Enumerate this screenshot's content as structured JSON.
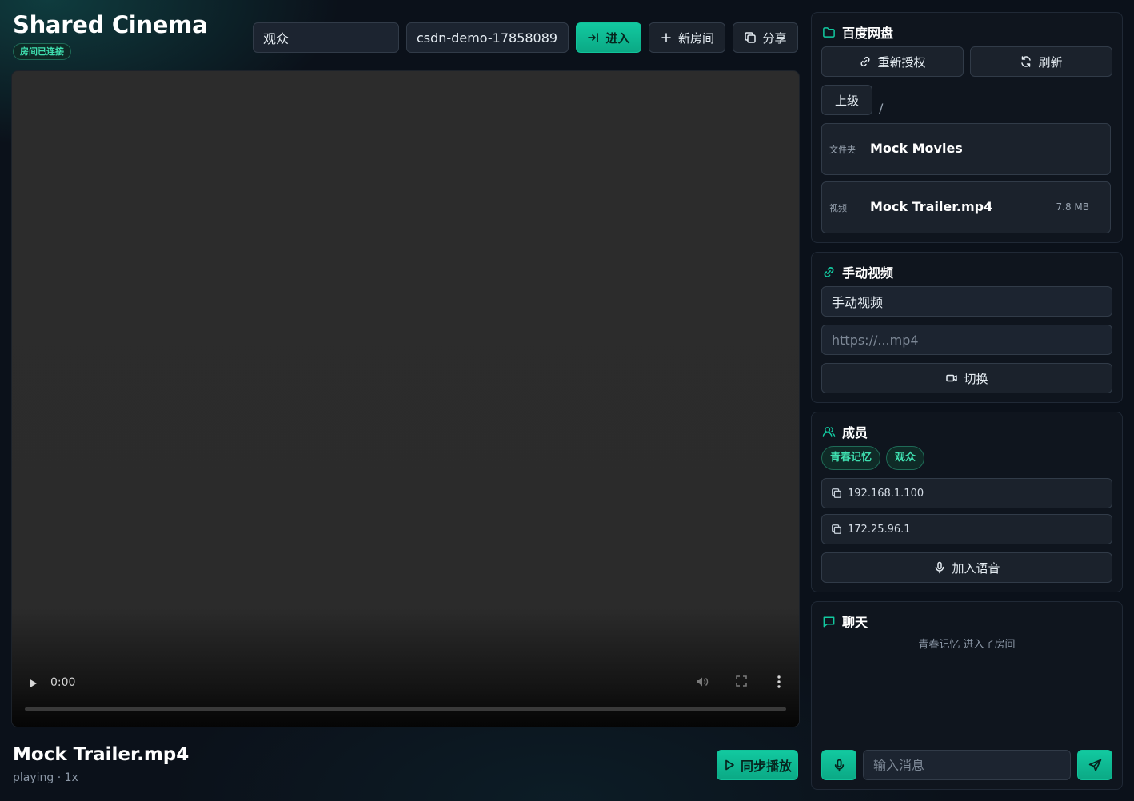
{
  "header": {
    "title": "Shared Cinema",
    "status_badge": "房间已连接",
    "nickname_value": "观众",
    "room_value": "csdn-demo-178580898",
    "enter_label": "进入",
    "new_room_label": "新房间",
    "share_label": "分享"
  },
  "player": {
    "time": "0:00",
    "now_title": "Mock Trailer.mp4",
    "now_status": "playing · 1x",
    "sync_label": "同步播放"
  },
  "baidu": {
    "title": "百度网盘",
    "reauth_label": "重新授权",
    "refresh_label": "刷新",
    "up_label": "上级",
    "path": "/",
    "items": [
      {
        "kind": "文件夹",
        "name": "Mock Movies",
        "size": ""
      },
      {
        "kind": "视频",
        "name": "Mock Trailer.mp4",
        "size": "7.8 MB"
      }
    ]
  },
  "manual": {
    "title": "手动视频",
    "name_value": "手动视频",
    "url_placeholder": "https://...mp4",
    "switch_label": "切换"
  },
  "members": {
    "title": "成员",
    "list": [
      "青春记忆",
      "观众"
    ],
    "ips": [
      "192.168.1.100",
      "172.25.96.1"
    ],
    "voice_label": "加入语音"
  },
  "chat": {
    "title": "聊天",
    "system_message": "青春记忆 进入了房间",
    "input_placeholder": "输入消息"
  },
  "colors": {
    "accent": "#12c9a0",
    "background": "#0b111a",
    "panel": "#10161f"
  }
}
